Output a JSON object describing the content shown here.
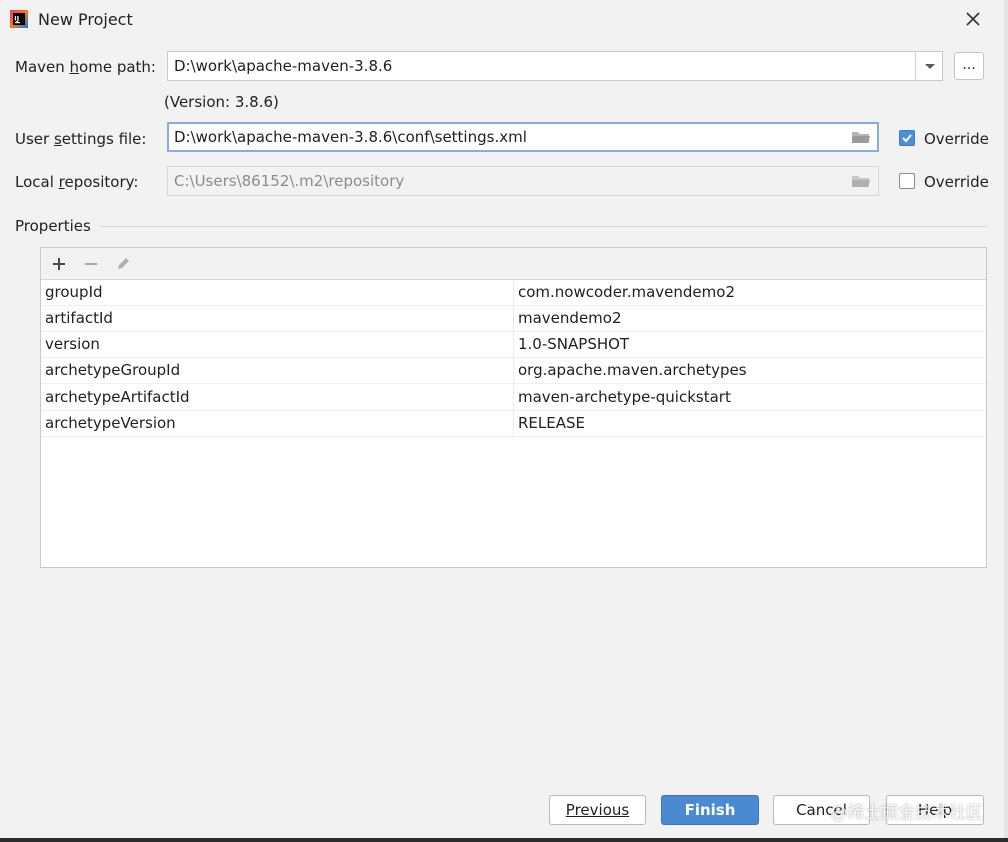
{
  "window": {
    "title": "New Project",
    "icon": "intellij-idea-icon",
    "close_icon": "close-icon"
  },
  "maven_home": {
    "label_before": "Maven ",
    "label_mnemonic": "h",
    "label_after": "ome path:",
    "value": "D:\\work\\apache-maven-3.8.6",
    "browse_label": "...",
    "version_text": "(Version: 3.8.6)"
  },
  "user_settings": {
    "label_before": "User ",
    "label_mnemonic": "s",
    "label_after": "ettings file:",
    "value": "D:\\work\\apache-maven-3.8.6\\conf\\settings.xml",
    "override_label": "Override",
    "override_checked": true
  },
  "local_repository": {
    "label_before": "Local ",
    "label_mnemonic": "r",
    "label_after": "epository:",
    "value": "C:\\Users\\86152\\.m2\\repository",
    "override_label": "Override",
    "override_checked": false
  },
  "properties": {
    "section_label": "Properties",
    "toolbar": {
      "add": "plus-icon",
      "remove": "minus-icon",
      "edit": "pencil-icon"
    },
    "rows": [
      {
        "key": "groupId",
        "value": "com.nowcoder.mavendemo2"
      },
      {
        "key": "artifactId",
        "value": "mavendemo2"
      },
      {
        "key": "version",
        "value": "1.0-SNAPSHOT"
      },
      {
        "key": "archetypeGroupId",
        "value": "org.apache.maven.archetypes"
      },
      {
        "key": "archetypeArtifactId",
        "value": "maven-archetype-quickstart"
      },
      {
        "key": "archetypeVersion",
        "value": "RELEASE"
      }
    ]
  },
  "buttons": {
    "previous": "Previous",
    "finish": "Finish",
    "cancel": "Cancel",
    "help": "Help"
  },
  "watermark": "@稀土掘金技术社区",
  "colors": {
    "accent": "#4a8ad3",
    "checkbox_on": "#4a90d9",
    "focus_border": "#87aeda"
  }
}
